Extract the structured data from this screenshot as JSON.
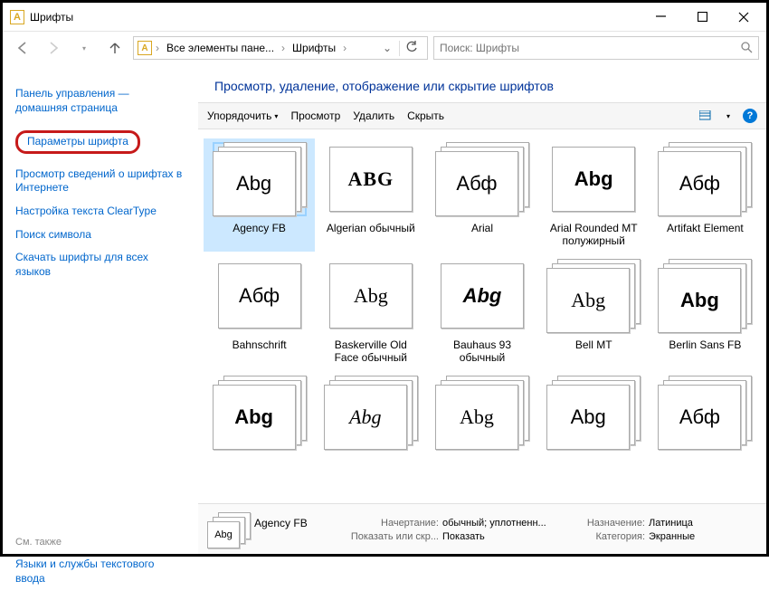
{
  "titlebar": {
    "title": "Шрифты"
  },
  "nav": {
    "crumb1": "Все элементы пане...",
    "crumb2": "Шрифты",
    "search_placeholder": "Поиск: Шрифты"
  },
  "sidebar": {
    "home1": "Панель управления —",
    "home2": "домашняя страница",
    "links": [
      "Параметры шрифта",
      "Просмотр сведений о шрифтах в Интернете",
      "Настройка текста ClearType",
      "Поиск символа",
      "Скачать шрифты для всех языков"
    ],
    "seealso": "См. также",
    "seealso_link": "Языки и службы текстового ввода"
  },
  "main": {
    "header": "Просмотр, удаление, отображение или скрытие шрифтов",
    "toolbar": {
      "organize": "Упорядочить",
      "view": "Просмотр",
      "delete": "Удалить",
      "hide": "Скрыть"
    }
  },
  "fonts": [
    {
      "label": "Agency FB",
      "sample": "Abg",
      "stack": true,
      "selected": true
    },
    {
      "label": "Algerian обычный",
      "sample": "ABG",
      "stack": false,
      "style": "font-family:serif;letter-spacing:1px;font-weight:bold"
    },
    {
      "label": "Arial",
      "sample": "Абф",
      "stack": true
    },
    {
      "label": "Arial Rounded MT полужирный",
      "sample": "Abg",
      "stack": false,
      "style": "font-weight:bold"
    },
    {
      "label": "Artifakt Element",
      "sample": "Абф",
      "stack": true
    },
    {
      "label": "Bahnschrift",
      "sample": "Абф",
      "stack": false
    },
    {
      "label": "Baskerville Old Face обычный",
      "sample": "Abg",
      "stack": false,
      "style": "font-family:serif"
    },
    {
      "label": "Bauhaus 93 обычный",
      "sample": "Abg",
      "stack": false,
      "style": "font-weight:900;font-style:italic"
    },
    {
      "label": "Bell MT",
      "sample": "Abg",
      "stack": true,
      "style": "font-family:serif"
    },
    {
      "label": "Berlin Sans FB",
      "sample": "Abg",
      "stack": true,
      "style": "font-weight:bold"
    },
    {
      "label": "",
      "sample": "Abg",
      "stack": true,
      "style": "font-weight:900"
    },
    {
      "label": "",
      "sample": "Abg",
      "stack": true,
      "style": "font-style:italic;font-family:cursive"
    },
    {
      "label": "",
      "sample": "Abg",
      "stack": true,
      "style": "font-family:serif"
    },
    {
      "label": "",
      "sample": "Abg",
      "stack": true,
      "style": "font-stretch:condensed"
    },
    {
      "label": "",
      "sample": "Абф",
      "stack": true
    }
  ],
  "details": {
    "name": "Agency FB",
    "k1": "Начертание:",
    "v1": "обычный; уплотненн...",
    "k2": "Показать или скр...",
    "v2": "Показать",
    "k3": "Назначение:",
    "v3": "Латиница",
    "k4": "Категория:",
    "v4": "Экранные",
    "mini_sample": "Abg"
  }
}
